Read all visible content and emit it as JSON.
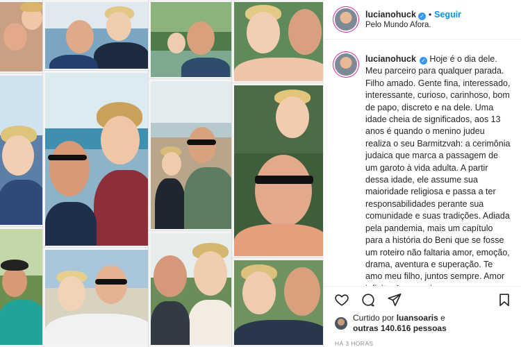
{
  "post": {
    "username": "lucianohuck",
    "follow_label": "Seguir",
    "location": "Pelo Mundo Afora.",
    "separator": "•"
  },
  "caption": {
    "username": "lucianohuck",
    "text": "Hoje é o dia dele. Meu parceiro para qualquer parada. Filho amado. Gente fina, interessado, interessante, curioso, carinhoso, bom de papo, discreto e na dele. Uma idade cheia de significados, aos 13 anos é quando o menino judeu realiza o seu Barmitzvah: a cerimônia judaica que marca a passagem de um garoto à vida adulta. A partir dessa idade, ele assume sua maioridade religiosa e passa a ter responsabilidades perante sua comunidade e suas tradições. Adiada pela pandemia, mais um capítulo para a história do Beni que se fosse um roteiro não faltaria amor, emoção, drama, aventura e superação. Te amo meu filho, juntos sempre. Amor infinito. Amor maior que eu."
  },
  "likes": {
    "prefix": "Curtido por",
    "user": "luansoaris",
    "connector": "e",
    "others": "outras 140.616 pessoas"
  },
  "timestamp": "HÁ 3 HORAS",
  "icons": {
    "like": "heart-icon",
    "comment": "comment-icon",
    "share": "share-icon",
    "save": "bookmark-icon"
  },
  "colors": {
    "accent": "#0095f6",
    "verified": "#3897f0",
    "muted": "#8e8e8e",
    "border": "#efefef"
  }
}
